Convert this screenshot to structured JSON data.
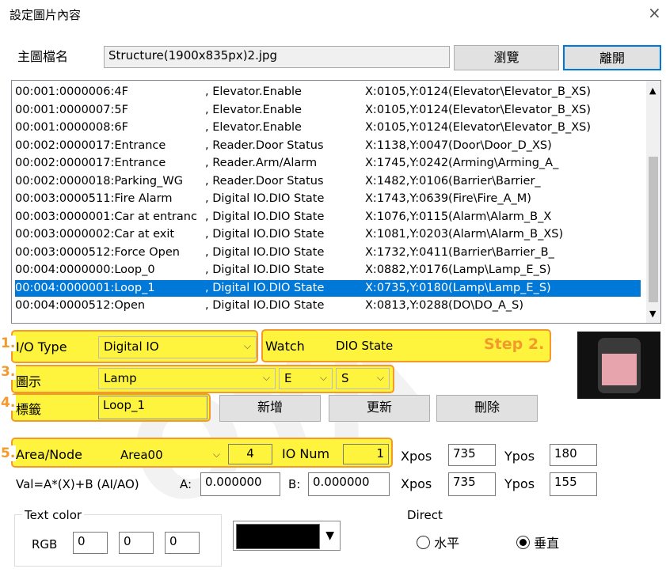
{
  "window": {
    "title": "設定圖片內容",
    "close": "×"
  },
  "file": {
    "label": "主圖檔名",
    "value": "Structure(1900x835px)2.jpg",
    "browse": "瀏覽",
    "exit": "離開"
  },
  "list": {
    "rows": [
      {
        "addr": "00:001:0000006:4F",
        "func": ", Elevator.Enable",
        "pos": "X:0105,Y:0124(Elevator\\Elevator_B_XS)"
      },
      {
        "addr": "00:001:0000007:5F",
        "func": ", Elevator.Enable",
        "pos": "X:0105,Y:0124(Elevator\\Elevator_B_XS)"
      },
      {
        "addr": "00:001:0000008:6F",
        "func": ", Elevator.Enable",
        "pos": "X:0105,Y:0124(Elevator\\Elevator_B_XS)"
      },
      {
        "addr": "00:002:0000017:Entrance",
        "func": ", Reader.Door Status",
        "pos": "X:1138,Y:0047(Door\\Door_D_XS)"
      },
      {
        "addr": "00:002:0000017:Entrance",
        "func": ", Reader.Arm/Alarm",
        "pos": "X:1745,Y:0242(Arming\\Arming_A_"
      },
      {
        "addr": "00:002:0000018:Parking_WG",
        "func": ", Reader.Door Status",
        "pos": "X:1482,Y:0106(Barrier\\Barrier_"
      },
      {
        "addr": "00:003:0000511:Fire Alarm",
        "func": ", Digital IO.DIO State",
        "pos": "X:1743,Y:0639(Fire\\Fire_A_M)"
      },
      {
        "addr": "00:003:0000001:Car at entranc",
        "func": ", Digital IO.DIO State",
        "pos": "X:1076,Y:0115(Alarm\\Alarm_B_X"
      },
      {
        "addr": "00:003:0000002:Car at exit",
        "func": ", Digital IO.DIO State",
        "pos": "X:1081,Y:0203(Alarm\\Alarm_B_XS)"
      },
      {
        "addr": "00:003:0000512:Force Open",
        "func": ", Digital IO.DIO State",
        "pos": "X:1732,Y:0411(Barrier\\Barrier_B_"
      },
      {
        "addr": "00:004:0000000:Loop_0",
        "func": ", Digital IO.DIO State",
        "pos": "X:0882,Y:0176(Lamp\\Lamp_E_S)"
      },
      {
        "addr": "00:004:0000001:Loop_1",
        "func": ", Digital IO.DIO State",
        "pos": "X:0735,Y:0180(Lamp\\Lamp_E_S)"
      },
      {
        "addr": "00:004:0000512:Open",
        "func": ", Digital IO.DIO State",
        "pos": "X:0813,Y:0288(DO\\DO_A_S)"
      }
    ],
    "selected_index": 11
  },
  "annot": {
    "n1": "1.",
    "n3": "3.",
    "n4": "4.",
    "n5": "5.",
    "step2": "Step 2."
  },
  "io": {
    "label": "I/O Type",
    "value": "Digital IO",
    "watch_label": "Watch",
    "watch_value": "DIO State"
  },
  "icon": {
    "label": "圖示",
    "value": "Lamp",
    "e": "E",
    "s": "S"
  },
  "tag": {
    "label": "標籤",
    "value": "Loop_1",
    "add": "新增",
    "update": "更新",
    "delete": "刪除"
  },
  "area": {
    "label": "Area/Node",
    "value": "Area00",
    "node": "4",
    "ionum_label": "IO Num",
    "ionum": "1",
    "xpos_label": "Xpos",
    "xpos": "735",
    "ypos_label": "Ypos",
    "ypos": "180"
  },
  "val": {
    "label": "Val=A*(X)+B (AI/AO)",
    "a_label": "A:",
    "a": "0.000000",
    "b_label": "B:",
    "b": "0.000000",
    "xpos_label": "Xpos",
    "xpos": "735",
    "ypos_label": "Ypos",
    "ypos": "155"
  },
  "color": {
    "label": "Text color",
    "rgb_label": "RGB",
    "r": "0",
    "g": "0",
    "b": "0",
    "swatch": "#000000"
  },
  "direct": {
    "label": "Direct",
    "horizontal": "水平",
    "vertical": "垂直",
    "selected": "vertical"
  },
  "colors": {
    "highlight": "#fff43d",
    "annot": "#f39a2b",
    "select": "#0078d7"
  }
}
